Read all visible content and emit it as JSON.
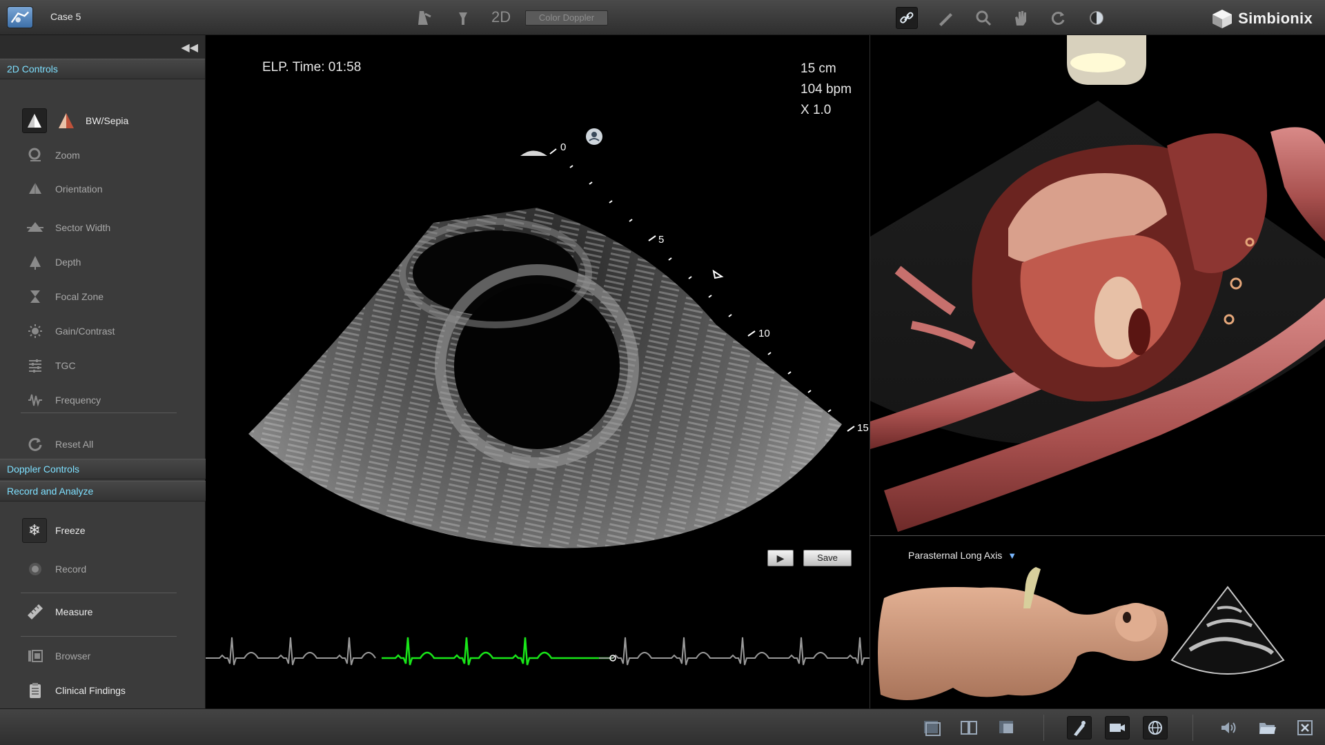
{
  "topbar": {
    "case_title": "Case 5",
    "mode_label": "2D",
    "color_doppler_label": "Color Doppler",
    "brand_name": "Simbionix",
    "brand_mark": "®",
    "icons": [
      "sector-probe-icon",
      "probe-icon",
      "2d-mode-icon",
      "link-icon",
      "pen-probe-icon",
      "magnifier-icon",
      "hand-icon",
      "rotate-icon",
      "contrast-icon"
    ]
  },
  "sidebar": {
    "collapse_glyph": "◀◀",
    "sections": {
      "controls_2d": "2D Controls",
      "doppler": "Doppler Controls",
      "record": "Record and Analyze"
    },
    "items_2d": [
      {
        "label": "BW/Sepia",
        "icon": "bw-sepia-icon"
      },
      {
        "label": "Zoom",
        "icon": "zoom-icon"
      },
      {
        "label": "Orientation",
        "icon": "orientation-icon"
      },
      {
        "label": "Sector Width",
        "icon": "sector-width-icon"
      },
      {
        "label": "Depth",
        "icon": "depth-icon"
      },
      {
        "label": "Focal Zone",
        "icon": "focal-zone-icon"
      },
      {
        "label": "Gain/Contrast",
        "icon": "gain-contrast-icon"
      },
      {
        "label": "TGC",
        "icon": "tgc-icon"
      },
      {
        "label": "Frequency",
        "icon": "frequency-icon"
      },
      {
        "label": "Reset All",
        "icon": "reset-icon"
      }
    ],
    "items_record": [
      {
        "label": "Freeze",
        "icon": "snowflake-icon"
      },
      {
        "label": "Record",
        "icon": "record-icon"
      },
      {
        "label": "Measure",
        "icon": "ruler-icon"
      },
      {
        "label": "Browser",
        "icon": "browser-icon"
      },
      {
        "label": "Clinical Findings",
        "icon": "clinical-findings-icon"
      }
    ]
  },
  "ultrasound": {
    "elp_time": "ELP. Time: 01:58",
    "depth": "15 cm",
    "heart_rate": "104 bpm",
    "zoom": "X 1.0",
    "depth_markers": [
      "0",
      "5",
      "10",
      "15"
    ],
    "save_label": "Save",
    "ecg_color": "#19e619"
  },
  "patient_view": {
    "view_name": "Parasternal Long Axis",
    "dropdown_glyph": "▼"
  },
  "bottombar": {
    "icons": [
      "single-layout-icon",
      "dual-layout-icon",
      "overlay-layout-icon",
      "probe-tool-icon",
      "camera-icon",
      "globe-icon",
      "volume-icon",
      "folder-icon",
      "close-icon"
    ]
  }
}
